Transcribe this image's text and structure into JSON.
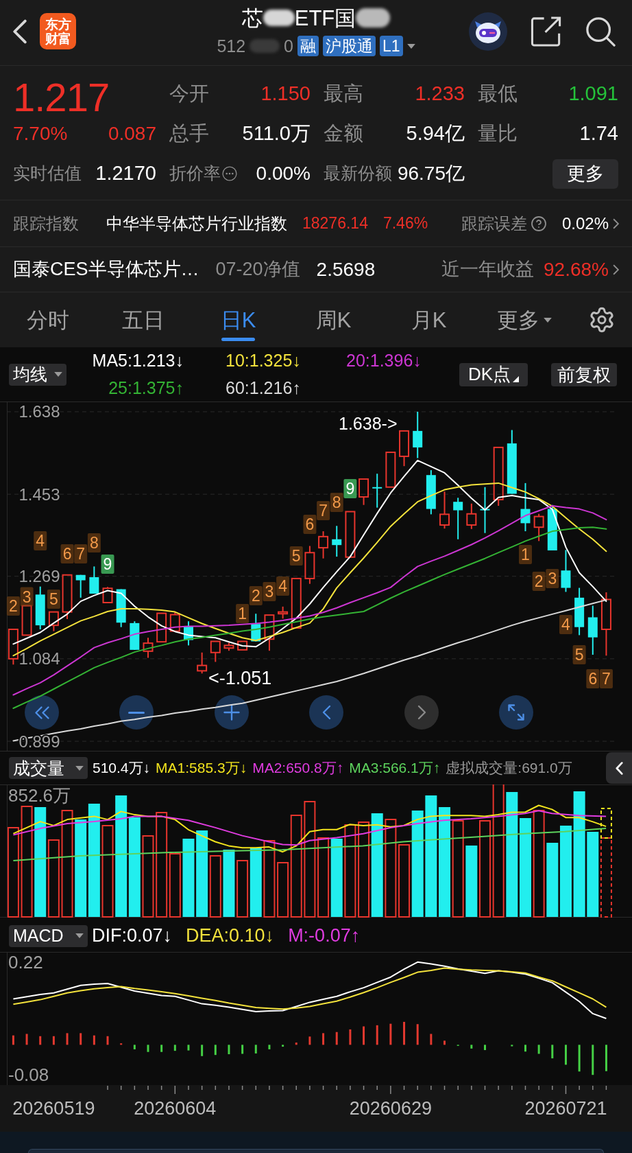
{
  "header": {
    "logo": [
      "东方",
      "财富"
    ],
    "title": [
      "芯",
      "ETF国"
    ],
    "code": [
      "512",
      "0"
    ],
    "badges": [
      "融",
      "沪股通",
      "L1"
    ]
  },
  "quote": {
    "price": "1.217",
    "change_percent": "7.70%",
    "change": "0.087",
    "stats": [
      {
        "label": "今开",
        "value": "1.150",
        "color": "#ee2f27"
      },
      {
        "label": "最高",
        "value": "1.233",
        "color": "#ee2f27"
      },
      {
        "label": "最低",
        "value": "1.091",
        "color": "#25c23a"
      },
      {
        "label": "总手",
        "value": "511.0万",
        "color": "#ffffff"
      },
      {
        "label": "金额",
        "value": "5.94亿",
        "color": "#ffffff"
      },
      {
        "label": "量比",
        "value": "1.74",
        "color": "#ffffff"
      }
    ],
    "estimate": {
      "label": "实时估值",
      "value": "1.2170"
    },
    "details": [
      {
        "label": "折价率",
        "value": "0.00%",
        "info": true
      },
      {
        "label": "最新份额",
        "value": "96.75亿",
        "info": false
      }
    ],
    "more": "更多"
  },
  "tracking": {
    "label": "跟踪指数",
    "index_name": "中华半导体芯片行业指数",
    "index_value": "18276.14",
    "index_change": "7.46%",
    "error_label": "跟踪误差",
    "error_value": "0.02%"
  },
  "fund": {
    "name": "国泰CES半导体芯片…",
    "nav_label": "07-20净值",
    "nav_value": "2.5698",
    "return_label": "近一年收益",
    "return_value": "92.68%"
  },
  "tabs": [
    {
      "label": "分时",
      "selected": false,
      "dropdown": false
    },
    {
      "label": "五日",
      "selected": false,
      "dropdown": false
    },
    {
      "label": "日K",
      "selected": true,
      "dropdown": false
    },
    {
      "label": "周K",
      "selected": false,
      "dropdown": false
    },
    {
      "label": "月K",
      "selected": false,
      "dropdown": false
    },
    {
      "label": "更多",
      "selected": false,
      "dropdown": true
    }
  ],
  "kline": {
    "selector": "均线",
    "legend": [
      {
        "text": "MA5:1.213↓",
        "color": "#ffffff"
      },
      {
        "text": "10:1.325↓",
        "color": "#f3e23c"
      },
      {
        "text": "20:1.396↓",
        "color": "#cc36d2"
      },
      {
        "text": "25:1.375↑",
        "color": "#34b334"
      },
      {
        "text": "60:1.216↑",
        "color": "#d9d9d9"
      }
    ],
    "buttons": [
      {
        "label": "DK点",
        "kind": "menu"
      },
      {
        "label": "前复权",
        "kind": "plain"
      }
    ],
    "chart_data": {
      "type": "candlestick",
      "grid": true,
      "ylim": [
        0.876,
        1.661
      ],
      "yticks": [
        {
          "value": 1.638,
          "label": "1.638"
        },
        {
          "value": 1.453,
          "label": "1.453"
        },
        {
          "value": 1.269,
          "label": "1.269"
        },
        {
          "value": 1.084,
          "label": "1.084"
        },
        {
          "value": 0.899,
          "label": "0.899"
        }
      ],
      "categories": [
        null,
        null,
        null,
        null,
        null,
        null,
        null,
        null,
        null,
        null,
        null,
        null,
        null,
        null,
        null,
        null,
        null,
        null,
        null,
        null,
        null,
        null,
        null,
        null,
        null,
        null,
        null,
        null,
        null,
        null,
        null,
        null,
        null,
        null,
        null,
        null,
        null,
        null,
        null,
        null,
        null,
        null,
        null,
        null,
        null
      ],
      "ohlc": [
        [
          1.084,
          1.15,
          1.071,
          1.15
        ],
        [
          1.137,
          1.203,
          1.137,
          1.203
        ],
        [
          1.228,
          1.246,
          1.15,
          1.159
        ],
        [
          1.159,
          1.189,
          1.146,
          1.189
        ],
        [
          1.189,
          1.272,
          1.173,
          1.272
        ],
        [
          1.272,
          1.272,
          1.221,
          1.26
        ],
        [
          1.267,
          1.291,
          1.23,
          1.23
        ],
        [
          1.21,
          1.245,
          1.21,
          1.242
        ],
        [
          1.24,
          1.24,
          1.155,
          1.165
        ],
        [
          1.164,
          1.168,
          1.104,
          1.104
        ],
        [
          1.101,
          1.131,
          1.086,
          1.119
        ],
        [
          1.122,
          1.186,
          1.122,
          1.186
        ],
        [
          1.146,
          1.189,
          1.146,
          1.183
        ],
        [
          1.156,
          1.168,
          1.114,
          1.126
        ],
        [
          1.057,
          1.098,
          1.051,
          1.069
        ],
        [
          1.098,
          1.123,
          1.077,
          1.123
        ],
        [
          1.108,
          1.12,
          1.102,
          1.114
        ],
        [
          1.104,
          1.123,
          1.104,
          1.123
        ],
        [
          1.162,
          1.185,
          1.123,
          1.123
        ],
        [
          1.128,
          1.182,
          1.102,
          1.182
        ],
        [
          1.185,
          1.201,
          1.174,
          1.189
        ],
        [
          1.153,
          1.264,
          1.153,
          1.264
        ],
        [
          1.264,
          1.337,
          1.252,
          1.322
        ],
        [
          1.333,
          1.37,
          1.309,
          1.358
        ],
        [
          1.352,
          1.382,
          1.313,
          1.339
        ],
        [
          1.312,
          1.414,
          1.312,
          1.414
        ],
        [
          1.447,
          1.487,
          1.429,
          1.487
        ],
        [
          1.469,
          1.499,
          1.423,
          1.466
        ],
        [
          1.469,
          1.547,
          1.469,
          1.547
        ],
        [
          1.538,
          1.595,
          1.516,
          1.595
        ],
        [
          1.595,
          1.638,
          1.534,
          1.558
        ],
        [
          1.496,
          1.507,
          1.408,
          1.42
        ],
        [
          1.384,
          1.459,
          1.376,
          1.408
        ],
        [
          1.436,
          1.445,
          1.352,
          1.417
        ],
        [
          1.384,
          1.432,
          1.375,
          1.409
        ],
        [
          1.42,
          1.469,
          1.366,
          1.417
        ],
        [
          1.441,
          1.558,
          1.427,
          1.558
        ],
        [
          1.567,
          1.597,
          1.454,
          1.454
        ],
        [
          1.42,
          1.478,
          1.37,
          1.388
        ],
        [
          1.379,
          1.409,
          1.348,
          1.403
        ],
        [
          1.42,
          1.429,
          1.327,
          1.327
        ],
        [
          1.282,
          1.328,
          1.234,
          1.243
        ],
        [
          1.221,
          1.243,
          1.137,
          1.155
        ],
        [
          1.177,
          1.203,
          1.093,
          1.132
        ],
        [
          1.15,
          1.233,
          1.091,
          1.217
        ]
      ],
      "series": [
        {
          "type": "line",
          "color": "#ffffff",
          "values": [
            1.117,
            1.13,
            1.143,
            1.164,
            1.184,
            1.213,
            1.226,
            1.237,
            1.231,
            1.202,
            1.178,
            1.158,
            1.145,
            1.137,
            1.134,
            1.131,
            1.122,
            1.113,
            1.111,
            1.13,
            1.152,
            1.175,
            1.207,
            1.244,
            1.279,
            1.313,
            1.362,
            1.41,
            1.456,
            1.493,
            1.529,
            1.515,
            1.501,
            1.473,
            1.444,
            1.418,
            1.446,
            1.45,
            1.445,
            1.441,
            1.419,
            1.334,
            1.277,
            1.246,
            1.213
          ]
        },
        {
          "type": "line",
          "color": "#f3e23c",
          "values": [
            1.091,
            1.107,
            1.124,
            1.139,
            1.154,
            1.169,
            1.179,
            1.19,
            1.196,
            1.196,
            1.195,
            1.193,
            1.189,
            1.176,
            1.163,
            1.152,
            1.141,
            1.131,
            1.125,
            1.134,
            1.143,
            1.154,
            1.164,
            1.196,
            1.243,
            1.277,
            1.31,
            1.345,
            1.381,
            1.409,
            1.436,
            1.45,
            1.463,
            1.469,
            1.474,
            1.476,
            1.478,
            1.468,
            1.458,
            1.443,
            1.426,
            1.4,
            1.375,
            1.352,
            1.325
          ]
        },
        {
          "type": "line",
          "color": "#cc36d2",
          "values": [
            1.003,
            1.017,
            1.03,
            1.048,
            1.068,
            1.088,
            1.109,
            1.12,
            1.129,
            1.139,
            1.145,
            1.15,
            1.155,
            1.157,
            1.157,
            1.158,
            1.159,
            1.161,
            1.163,
            1.166,
            1.17,
            1.175,
            1.18,
            1.188,
            1.198,
            1.21,
            1.221,
            1.232,
            1.244,
            1.268,
            1.291,
            1.303,
            1.314,
            1.327,
            1.34,
            1.355,
            1.371,
            1.388,
            1.405,
            1.416,
            1.427,
            1.423,
            1.42,
            1.411,
            1.396
          ]
        },
        {
          "type": "line",
          "color": "#34b334",
          "values": [
            0.973,
            0.987,
            1.0,
            1.016,
            1.032,
            1.048,
            1.064,
            1.076,
            1.087,
            1.099,
            1.107,
            1.114,
            1.122,
            1.128,
            1.132,
            1.137,
            1.141,
            1.146,
            1.15,
            1.155,
            1.161,
            1.167,
            1.173,
            1.178,
            1.182,
            1.186,
            1.19,
            1.205,
            1.22,
            1.234,
            1.247,
            1.26,
            1.273,
            1.285,
            1.297,
            1.309,
            1.322,
            1.335,
            1.348,
            1.359,
            1.37,
            1.374,
            1.378,
            1.379,
            1.375
          ]
        },
        {
          "type": "line",
          "color": "#d9d9d9",
          "values": [
            0.9,
            0.906,
            0.911,
            0.917,
            0.922,
            0.927,
            0.933,
            0.938,
            0.944,
            0.948,
            0.953,
            0.957,
            0.962,
            0.966,
            0.971,
            0.975,
            0.98,
            0.984,
            0.991,
            0.998,
            1.005,
            1.012,
            1.019,
            1.026,
            1.033,
            1.042,
            1.051,
            1.061,
            1.071,
            1.081,
            1.09,
            1.1,
            1.11,
            1.12,
            1.129,
            1.139,
            1.149,
            1.159,
            1.168,
            1.176,
            1.184,
            1.192,
            1.2,
            1.208,
            1.216
          ]
        }
      ]
    },
    "high_marker": "1.638->",
    "low_marker": "<-1.051",
    "td_marks": [
      {
        "label": "2",
        "complete": false
      },
      {
        "label": "3",
        "complete": false
      },
      {
        "label": "4",
        "complete": false
      },
      {
        "label": "5",
        "complete": false
      },
      {
        "label": "6",
        "complete": false
      },
      {
        "label": "7",
        "complete": false
      },
      {
        "label": "8",
        "complete": false
      },
      {
        "label": "9",
        "complete": true
      },
      {
        "label": "1",
        "complete": false
      },
      {
        "label": "2",
        "complete": false
      },
      {
        "label": "3",
        "complete": false
      },
      {
        "label": "4",
        "complete": false
      },
      {
        "label": "5",
        "complete": false
      },
      {
        "label": "6",
        "complete": false
      },
      {
        "label": "7",
        "complete": false
      },
      {
        "label": "8",
        "complete": false
      },
      {
        "label": "9",
        "complete": true
      },
      {
        "label": "1",
        "complete": false
      },
      {
        "label": "2",
        "complete": false
      },
      {
        "label": "3",
        "complete": false
      },
      {
        "label": "4",
        "complete": false
      },
      {
        "label": "5",
        "complete": false
      },
      {
        "label": "6",
        "complete": false
      },
      {
        "label": "7",
        "complete": false
      }
    ],
    "nav_buttons": [
      {
        "kind": "rewind",
        "disabled": false
      },
      {
        "kind": "zoom_out",
        "disabled": false
      },
      {
        "kind": "zoom_in",
        "disabled": false
      },
      {
        "kind": "back",
        "disabled": false
      },
      {
        "kind": "forward",
        "disabled": true
      },
      {
        "kind": "expand",
        "disabled": false
      }
    ]
  },
  "volume": {
    "selector": "成交量",
    "legend": [
      {
        "text": "510.4万↓",
        "color": "#ffffff"
      },
      {
        "text": "MA1:585.3万↓",
        "color": "#f2e41d"
      },
      {
        "text": "MA2:650.8万↑",
        "color": "#e03ce0"
      },
      {
        "text": "MA3:566.1万↑",
        "color": "#5dd35d"
      },
      {
        "text": "虚拟成交量:691.0万",
        "color": "#9a9a9a"
      }
    ],
    "y_label": "852.6万"
  },
  "macd": {
    "selector": "MACD",
    "legend": [
      {
        "text": "DIF:0.07↓",
        "color": "#ffffff"
      },
      {
        "text": "DEA:0.10↓",
        "color": "#f3e23c"
      },
      {
        "text": "M:-0.07↑",
        "color": "#e03ce0"
      }
    ],
    "chart_data": {
      "type": "line",
      "ylim": [
        -0.107,
        0.247
      ],
      "yticks": [
        {
          "value": 0.22,
          "label": "0.22"
        },
        {
          "value": -0.08,
          "label": "-0.08"
        }
      ],
      "categories": [
        null,
        null,
        null,
        "20260519",
        null,
        null,
        null,
        null,
        null,
        null,
        null,
        null,
        "20260604",
        null,
        null,
        null,
        null,
        null,
        null,
        null,
        null,
        null,
        null,
        null,
        null,
        null,
        null,
        null,
        "20260629",
        null,
        null,
        null,
        null,
        null,
        null,
        null,
        null,
        null,
        null,
        null,
        null,
        "20260721",
        null,
        null,
        null
      ],
      "series": [
        {
          "type": "bar",
          "color": "#e4392f",
          "values": [
            0.025,
            0.029,
            0.023,
            0.023,
            0.031,
            0.031,
            0.025,
            0.023,
            0.004,
            null,
            null,
            null,
            null,
            null,
            null,
            null,
            null,
            null,
            null,
            null,
            null,
            0.006,
            0.022,
            0.031,
            0.034,
            0.041,
            0.049,
            0.052,
            0.056,
            0.061,
            0.055,
            0.029,
            0.011,
            null,
            null,
            null,
            null,
            null,
            null,
            null,
            null,
            null,
            null,
            null,
            null
          ]
        },
        {
          "type": "bar",
          "color": "#45d045",
          "values": [
            null,
            null,
            null,
            null,
            null,
            null,
            null,
            null,
            null,
            -0.012,
            -0.019,
            -0.019,
            -0.016,
            -0.015,
            -0.03,
            -0.027,
            -0.025,
            -0.024,
            -0.023,
            -0.012,
            -0.005,
            null,
            null,
            null,
            null,
            null,
            null,
            null,
            null,
            null,
            null,
            null,
            null,
            -0.002,
            -0.01,
            -0.014,
            null,
            -0.004,
            -0.018,
            -0.024,
            -0.036,
            -0.053,
            -0.071,
            -0.08,
            -0.07
          ]
        },
        {
          "type": "line",
          "color": "#ffffff",
          "values": [
            0.122,
            0.128,
            0.134,
            0.138,
            0.148,
            0.158,
            0.161,
            0.163,
            0.153,
            0.143,
            0.137,
            0.131,
            0.129,
            0.119,
            0.109,
            0.105,
            0.1,
            0.094,
            0.088,
            0.09,
            0.091,
            0.102,
            0.113,
            0.121,
            0.129,
            0.141,
            0.152,
            0.166,
            0.18,
            0.201,
            0.22,
            0.215,
            0.209,
            0.202,
            0.196,
            0.19,
            0.197,
            0.193,
            0.188,
            0.177,
            0.165,
            0.14,
            0.115,
            0.083,
            0.07
          ]
        },
        {
          "type": "line",
          "color": "#f3e23c",
          "values": [
            0.108,
            0.114,
            0.12,
            0.129,
            0.138,
            0.144,
            0.149,
            0.152,
            0.155,
            0.15,
            0.146,
            0.141,
            0.136,
            0.13,
            0.124,
            0.118,
            0.111,
            0.105,
            0.099,
            0.097,
            0.095,
            0.098,
            0.102,
            0.109,
            0.116,
            0.127,
            0.139,
            0.152,
            0.166,
            0.179,
            0.193,
            0.198,
            0.204,
            0.201,
            0.199,
            0.198,
            0.197,
            0.194,
            0.191,
            0.18,
            0.17,
            0.154,
            0.138,
            0.122,
            0.1
          ]
        }
      ]
    }
  }
}
